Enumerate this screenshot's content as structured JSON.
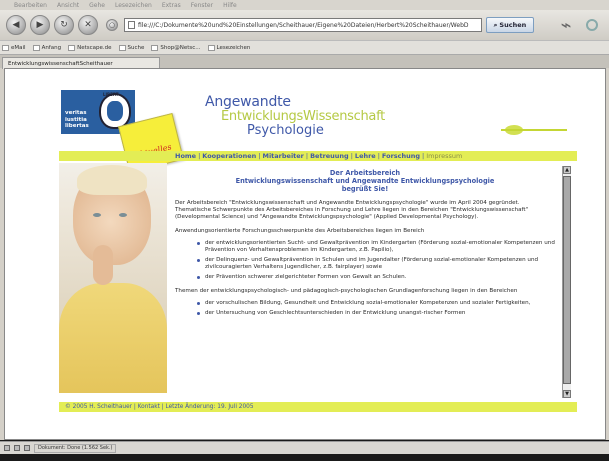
{
  "browser": {
    "menu": [
      "Bearbeiten",
      "Ansicht",
      "Gehe",
      "Lesezeichen",
      "Extras",
      "Fenster",
      "Hilfe"
    ],
    "url": "file:///C:/Dokumente%20und%20Einstellungen/Scheithauer/Eigene%20Dateien/Herbert%20Scheithauer/WebD",
    "search_label": "Suchen",
    "bookmarks": [
      "eMail",
      "Anfang",
      "Netscape.de",
      "Suche",
      "Shop@Netsc...",
      "Lesezeichen"
    ],
    "tab_title": "EntwicklungswissenschaftScheithauer",
    "status_text": "Dokument: Done (1.562 Sek.)"
  },
  "site": {
    "logo_text": [
      "veritas",
      "iustitia",
      "libertas"
    ],
    "logo_top": "LIBERT",
    "sticky_label": "Aktuelles",
    "title_line1": "Angewandte",
    "title_line2": "EntwicklungsWissenschaft",
    "title_line3": "Psychologie",
    "nav": [
      "Home",
      "Kooperationen",
      "Mitarbeiter",
      "Betreuung",
      "Lehre",
      "Forschung",
      "Impressum"
    ],
    "heading1": "Der Arbeitsbereich",
    "heading2": "Entwicklungswissenschaft und Angewandte Entwicklungspsychologie",
    "heading3": "begrüßt Sie!",
    "p1": "Der Arbeitsbereich \"Entwicklungswissenschaft und Angewandte Entwicklungspsychologie\" wurde im April 2004 gegründet. Thematische Schwerpunkte des Arbeitsbereiches in Forschung und Lehre liegen in den Bereichen \"Entwicklungswissenschaft\" (Developmental Science) und \"Angewandte Entwicklungspsychologie\" (Applied Developmental Psychology).",
    "p2": "Anwendungsorientierte Forschungsschwerpunkte des Arbeitsbereiches liegen im Bereich",
    "list1": [
      "der entwicklungsorientierten Sucht- und Gewaltprävention im Kindergarten (Förderung sozial-emotionaler Kompetenzen und Prävention von Verhaltensproblemen im Kindergarten, z.B. Papilio),",
      "der Delinquenz- und Gewaltprävention in Schulen und im Jugendalter (Förderung sozial-emotionaler Kompetenzen und zivilcouragierten Verhaltens Jugendlicher, z.B. fairplayer) sowie",
      "der Prävention schwerer zielgerichteter Formen von Gewalt an Schulen."
    ],
    "p3": "Themen der entwicklungspsychologisch- und pädagogisch-psychologischen Grundlagenforschung liegen in den Bereichen",
    "list2": [
      "der vorschulischen Bildung, Gesundheit und Entwicklung sozial-emotionaler Kompetenzen und sozialer Fertigkeiten,",
      "der Untersuchung von Geschlechtsunterschieden in der Entwicklung unangst-rischer Formen"
    ],
    "footer": "© 2005 H. Scheithauer | Kontakt | Letzte Änderung: 19. Juli 2005"
  }
}
